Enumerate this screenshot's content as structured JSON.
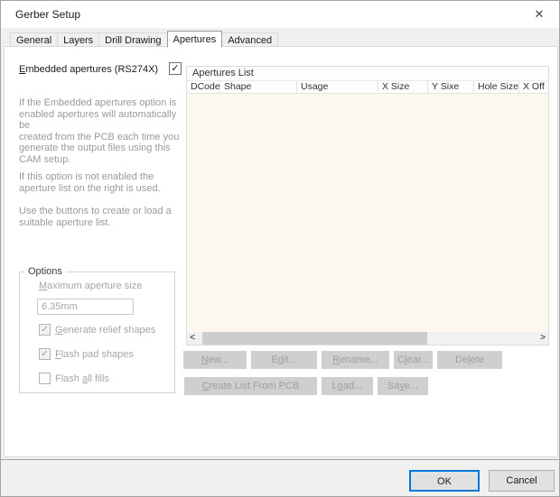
{
  "window": {
    "title": "Gerber Setup"
  },
  "glyphs": {
    "close": "✕",
    "check": "✓",
    "scroll_left": "<",
    "scroll_right": ">"
  },
  "tabs": [
    {
      "label": "General"
    },
    {
      "label": "Layers"
    },
    {
      "label": "Drill Drawing"
    },
    {
      "label": "Apertures",
      "active": true
    },
    {
      "label": "Advanced"
    }
  ],
  "embedded_checkbox": {
    "pre": "",
    "accel": "E",
    "post": "mbedded apertures (RS274X)",
    "checked": true
  },
  "description": {
    "p1": "If the Embedded apertures option is\nenabled apertures will automatically be\ncreated from the PCB each time you\ngenerate the output files using this\nCAM setup.",
    "p2": "If this option is not enabled the\naperture list on the right is used.",
    "p3": "Use the buttons to create or load a\nsuitable aperture list."
  },
  "options": {
    "title": "Options",
    "max_label": {
      "pre": "",
      "accel": "M",
      "post": "aximum aperture size"
    },
    "max_value": "6.35mm",
    "cb_generate": {
      "pre": "",
      "accel": "G",
      "post": "enerate relief shapes",
      "checked": true
    },
    "cb_flash_pads": {
      "pre": "",
      "accel": "F",
      "post": "lash pad shapes",
      "checked": true
    },
    "cb_flash_fills": {
      "pre": "Flash ",
      "accel": "a",
      "post": "ll fills",
      "checked": false
    }
  },
  "list": {
    "title": "Apertures List",
    "columns": [
      "DCode",
      "Shape",
      "Usage",
      "X Size",
      "Y Sixe",
      "Hole Size",
      "X Off"
    ],
    "rows": []
  },
  "buttons": {
    "new": {
      "pre": "",
      "accel": "N",
      "post": "ew..."
    },
    "edit": {
      "pre": "E",
      "accel": "d",
      "post": "it..."
    },
    "rename": {
      "pre": "",
      "accel": "R",
      "post": "ename..."
    },
    "clear": {
      "pre": "C",
      "accel": "l",
      "post": "ear..."
    },
    "delete": {
      "pre": "De",
      "accel": "l",
      "post": "ete"
    },
    "create": {
      "pre": "",
      "accel": "C",
      "post": "reate List From PCB"
    },
    "load": {
      "pre": "L",
      "accel": "o",
      "post": "ad..."
    },
    "save": {
      "pre": "Sa",
      "accel": "v",
      "post": "e..."
    }
  },
  "footer": {
    "ok": "OK",
    "cancel": "Cancel"
  },
  "colors": {
    "accent": "#0078d7",
    "list_body": "#fcf8ed",
    "disabled_button_bg": "#cfcfcf",
    "disabled_text": "#a6a6a6",
    "dialog_bg": "#f0f0f0"
  }
}
